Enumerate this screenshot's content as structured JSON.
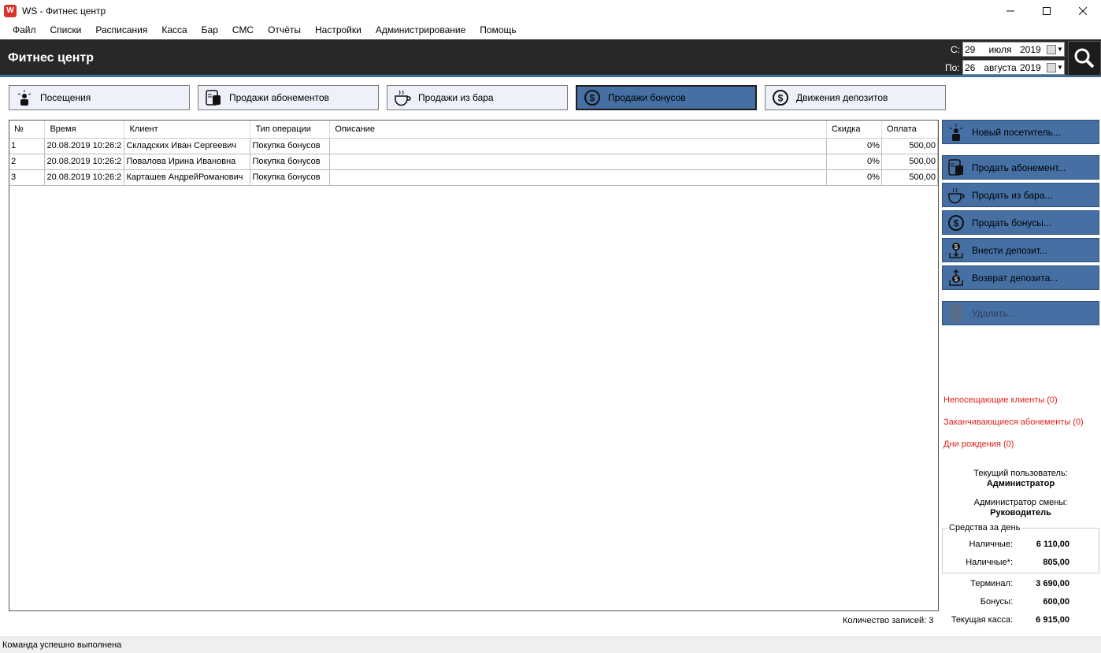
{
  "window": {
    "app_icon_text": "W",
    "title": "WS - Фитнес центр"
  },
  "menu": [
    "Файл",
    "Списки",
    "Расписания",
    "Касса",
    "Бар",
    "СМС",
    "Отчёты",
    "Настройки",
    "Администрирование",
    "Помощь"
  ],
  "header": {
    "title": "Фитнес центр",
    "from_label": "С:",
    "to_label": "По:",
    "from_date": {
      "day": "29",
      "month": "июля",
      "year": "2019"
    },
    "to_date": {
      "day": "26",
      "month": "августа",
      "year": "2019"
    }
  },
  "tabs": [
    {
      "label": "Посещения",
      "icon": "visitor-icon",
      "active": false
    },
    {
      "label": "Продажи абонементов",
      "icon": "membership-card-icon",
      "active": false
    },
    {
      "label": "Продажи из бара",
      "icon": "cup-icon",
      "active": false
    },
    {
      "label": "Продажи бонусов",
      "icon": "dollar-coin-icon",
      "active": true
    },
    {
      "label": "Движения депозитов",
      "icon": "dollar-coin-icon",
      "active": false
    }
  ],
  "table": {
    "columns": [
      "№",
      "Время",
      "Клиент",
      "Тип операции",
      "Описание",
      "Скидка",
      "Оплата"
    ],
    "rows": [
      [
        "1",
        "20.08.2019 10:26:2",
        "Складских Иван Сергеевич",
        "Покупка бонусов",
        "",
        "0%",
        "500,00"
      ],
      [
        "2",
        "20.08.2019 10:26:2",
        "Повалова Ирина Ивановна",
        "Покупка бонусов",
        "",
        "0%",
        "500,00"
      ],
      [
        "3",
        "20.08.2019 10:26:2",
        "Карташев АндрейРоманович",
        "Покупка бонусов",
        "",
        "0%",
        "500,00"
      ]
    ],
    "records_count": "Количество записей: 3"
  },
  "actions": {
    "new_visitor": "Новый посетитель...",
    "sell_membership": "Продать абонемент...",
    "sell_bar": "Продать из бара...",
    "sell_bonuses": "Продать бонусы...",
    "deposit_in": "Внести депозит...",
    "deposit_return": "Возврат депозита...",
    "delete": "Удалить..."
  },
  "alerts": {
    "non_visiting": "Непосещающие клиенты (0)",
    "expiring": "Заканчивающиеся абонементы (0)",
    "birthdays": "Дни рождения (0)"
  },
  "user": {
    "current_user_label": "Текущий пользователь:",
    "current_user": "Администратор",
    "shift_admin_label": "Администратор смены:",
    "shift_admin": "Руководитель"
  },
  "funds": {
    "title": "Средства за день",
    "rows": [
      {
        "label": "Наличные:",
        "value": "6 110,00"
      },
      {
        "label": "Наличные*:",
        "value": "805,00"
      },
      {
        "label": "Терминал:",
        "value": "3 690,00"
      },
      {
        "label": "Бонусы:",
        "value": "600,00"
      },
      {
        "label": "Текущая касса:",
        "value": "6 915,00"
      }
    ]
  },
  "status": "Команда успешно выполнена"
}
